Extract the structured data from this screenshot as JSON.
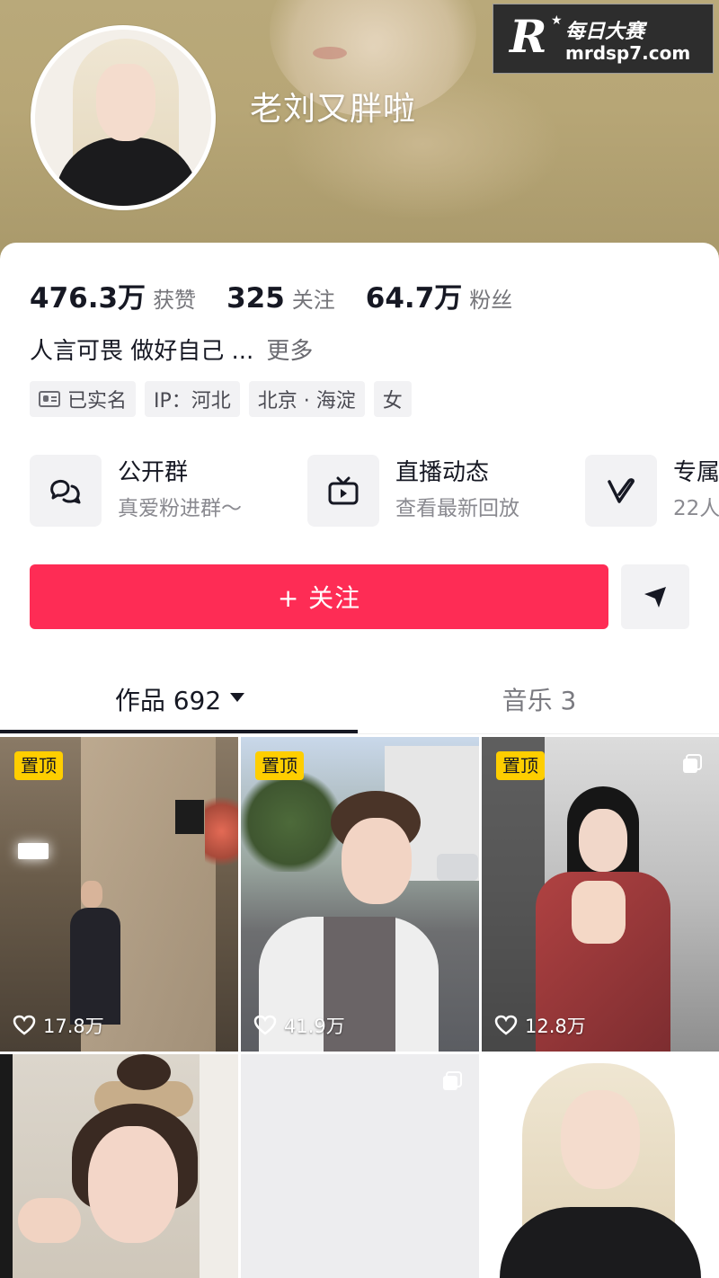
{
  "watermark": {
    "logo": "R",
    "title": "每日大赛",
    "url": "mrdsp7.com"
  },
  "profile": {
    "username": "老刘又胖啦",
    "stats": [
      {
        "value": "476.3万",
        "label": "获赞"
      },
      {
        "value": "325",
        "label": "关注"
      },
      {
        "value": "64.7万",
        "label": "粉丝"
      }
    ],
    "bio": "人言可畏 做好自己 ...",
    "bio_more": "更多",
    "tags": [
      "已实名",
      "IP：河北",
      "北京 · 海淀",
      "女"
    ]
  },
  "features": [
    {
      "title": "公开群",
      "subtitle": "真爱粉进群～",
      "icon": "group-chat-icon"
    },
    {
      "title": "直播动态",
      "subtitle": "查看最新回放",
      "icon": "tv-play-icon"
    },
    {
      "title": "专属",
      "subtitle": "22人",
      "icon": "v-fan-icon"
    }
  ],
  "actions": {
    "follow_label": "+ 关注",
    "share_icon": "send-icon"
  },
  "tabs": {
    "works": "作品 692",
    "music": "音乐 3"
  },
  "videos": [
    {
      "pinned": "置顶",
      "likes": "17.8万"
    },
    {
      "pinned": "置顶",
      "likes": "41.9万"
    },
    {
      "pinned": "置顶",
      "likes": "12.8万"
    },
    {
      "pinned": "",
      "likes": ""
    },
    {
      "pinned": "",
      "likes": ""
    },
    {
      "pinned": "",
      "likes": ""
    }
  ],
  "colors": {
    "follow": "#fe2c55",
    "pin": "#fece00",
    "banner": "#b7a676"
  }
}
